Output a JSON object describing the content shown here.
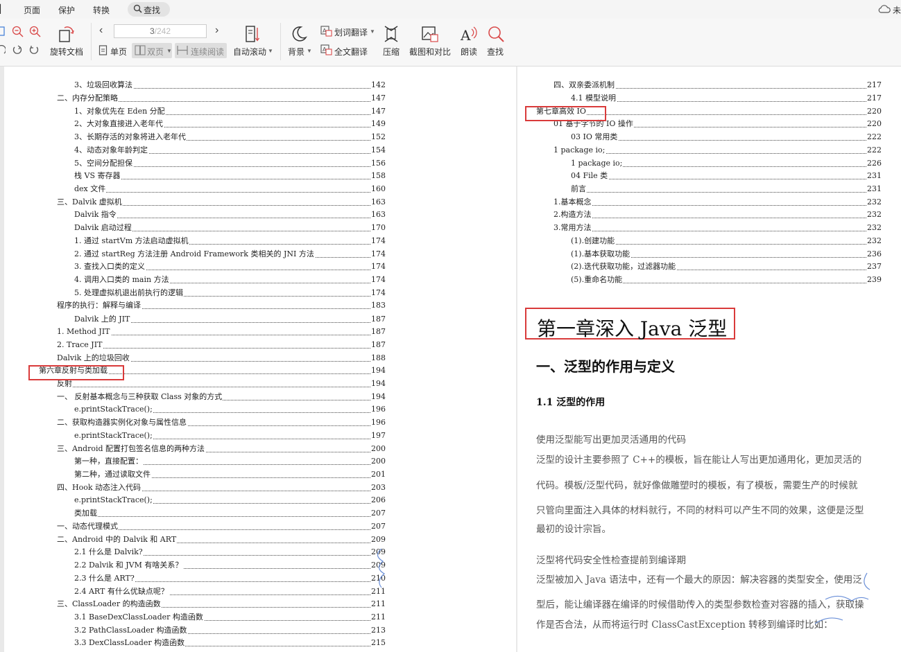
{
  "menu": {
    "items": [
      "页面",
      "保护",
      "转换"
    ],
    "search_label": "查找",
    "cloud_label": "未"
  },
  "toolbar": {
    "rotate_label": "旋转文档",
    "page_current": "3",
    "page_total": "/242",
    "single_label": "单页",
    "double_label": "双页",
    "continuous_label": "连续阅读",
    "autoscroll_label": "自动滚动",
    "background_label": "背景",
    "word_translate_label": "划词翻译",
    "full_translate_label": "全文翻译",
    "compress_label": "压缩",
    "screenshot_compare_label": "截图和对比",
    "read_aloud_label": "朗读",
    "find_label": "查找"
  },
  "left_toc": [
    {
      "t": "3、垃圾回收算法",
      "n": "142"
    },
    {
      "t": "二、内存分配策略",
      "n": "147"
    },
    {
      "t": "1、对象优先在 Eden 分配",
      "n": "147"
    },
    {
      "t": "2、大对象直接进入老年代",
      "n": "149"
    },
    {
      "t": "3、长期存活的对象将进入老年代",
      "n": "152"
    },
    {
      "t": "4、动态对象年龄判定",
      "n": "154"
    },
    {
      "t": "5、空间分配担保",
      "n": "156"
    },
    {
      "t": "栈 VS 寄存器",
      "n": "158"
    },
    {
      "t": "dex 文件",
      "n": "160"
    },
    {
      "t": "三、Dalvik 虚拟机",
      "n": "163"
    },
    {
      "t": "Dalvik 指令",
      "n": "163"
    },
    {
      "t": "Dalvik 启动过程",
      "n": "170"
    },
    {
      "t": "1. 通过 startVm 方法启动虚拟机",
      "n": "174"
    },
    {
      "t": "2. 通过 startReg 方法注册 Android Framework 类相关的 JNI 方法",
      "n": "174"
    },
    {
      "t": "3. 查找入口类的定义",
      "n": "174"
    },
    {
      "t": "4. 调用入口类的 main 方法",
      "n": "174"
    },
    {
      "t": "5. 处理虚拟机退出前执行的逻辑",
      "n": "174"
    },
    {
      "t": "程序的执行：解释与编译",
      "n": "183"
    },
    {
      "t": "Dalvik 上的 JIT",
      "n": "187"
    },
    {
      "t": "1. Method JIT",
      "n": "187"
    },
    {
      "t": "2. Trace JIT",
      "n": "187"
    },
    {
      "t": "Dalvik 上的垃圾回收",
      "n": "188"
    },
    {
      "t": "第六章反射与类加载",
      "n": "194"
    },
    {
      "t": "反射",
      "n": "194"
    },
    {
      "t": "一、 反射基本概念与三种获取 Class 对象的方式",
      "n": "194"
    },
    {
      "t": "e.printStackTrace();",
      "n": "196"
    },
    {
      "t": "二、获取构造器实例化对象与属性信息",
      "n": "196"
    },
    {
      "t": "e.printStackTrace();",
      "n": "197"
    },
    {
      "t": "三、Android 配置打包签名信息的两种方法",
      "n": "200"
    },
    {
      "t": "第一种，直接配置：",
      "n": "200"
    },
    {
      "t": "第二种，通过读取文件",
      "n": "201"
    },
    {
      "t": "四、Hook 动态注入代码",
      "n": "203"
    },
    {
      "t": "e.printStackTrace();",
      "n": "206"
    },
    {
      "t": "类加载",
      "n": "207"
    },
    {
      "t": "一、动态代理模式",
      "n": "207"
    },
    {
      "t": "二、Android 中的 Dalvik 和 ART",
      "n": "209"
    },
    {
      "t": "2.1 什么是 Dalvik?",
      "n": "209"
    },
    {
      "t": "2.2 Dalvik 和 JVM 有啥关系？",
      "n": "209"
    },
    {
      "t": "2.3 什么是 ART?",
      "n": "210"
    },
    {
      "t": "2.4 ART 有什么优缺点呢？",
      "n": "211"
    },
    {
      "t": "三、ClassLoader 的构造函数",
      "n": "211"
    },
    {
      "t": "3.1 BaseDexClassLoader 构造函数",
      "n": "211"
    },
    {
      "t": "3.2 PathClassLoader 构造函数",
      "n": "213"
    },
    {
      "t": "3.3 DexClassLoader 构造函数",
      "n": "215"
    }
  ],
  "right_toc": [
    {
      "t": "四、双亲委派机制",
      "n": "217"
    },
    {
      "t": "4.1 模型说明",
      "n": "217"
    },
    {
      "t": "第七章高效 IO",
      "n": "220"
    },
    {
      "t": "01 基于字节的 IO 操作",
      "n": "220"
    },
    {
      "t": "03 IO 常用类",
      "n": "222"
    },
    {
      "t": "1 package io;",
      "n": "222"
    },
    {
      "t": "1 package io;",
      "n": "226"
    },
    {
      "t": "04 File 类",
      "n": "231"
    },
    {
      "t": "前言",
      "n": "231"
    },
    {
      "t": "1.基本概念",
      "n": "232"
    },
    {
      "t": "2.构造方法",
      "n": "232"
    },
    {
      "t": "3.常用方法",
      "n": "232"
    },
    {
      "t": "(1).创建功能",
      "n": "232"
    },
    {
      "t": "(1).基本获取功能",
      "n": "236"
    },
    {
      "t": "(2).迭代获取功能，过滤器功能",
      "n": "237"
    },
    {
      "t": "(5).重命名功能",
      "n": "239"
    }
  ],
  "content": {
    "chapter_title": "第一章深入 Java 泛型",
    "section_title": "一、泛型的作用与定义",
    "subsection_title": "1.1 泛型的作用",
    "p1_heading": "使用泛型能写出更加灵活通用的代码",
    "p1_l1": "泛型的设计主要参照了 C++的模板，旨在能让人写出更加通用化，更加灵活的",
    "p1_l2": "代码。模板/泛型代码，就好像做雕塑时的模板，有了模板，需要生产的时候就",
    "p1_l3": "只管向里面注入具体的材料就行，不同的材料可以产生不同的效果，这便是泛型",
    "p1_l4": "最初的设计宗旨。",
    "p2_heading": "泛型将代码安全性检查提前到编译期",
    "p2_l1": "泛型被加入 Java 语法中，还有一个最大的原因：解决容器的类型安全，使用泛",
    "p2_l2": "型后，能让编译器在编译的时候借助传入的类型参数检查对容器的插入，获取操",
    "p2_l3": "作是否合法，从而将运行时 ClassCastException 转移到编译时比如："
  }
}
